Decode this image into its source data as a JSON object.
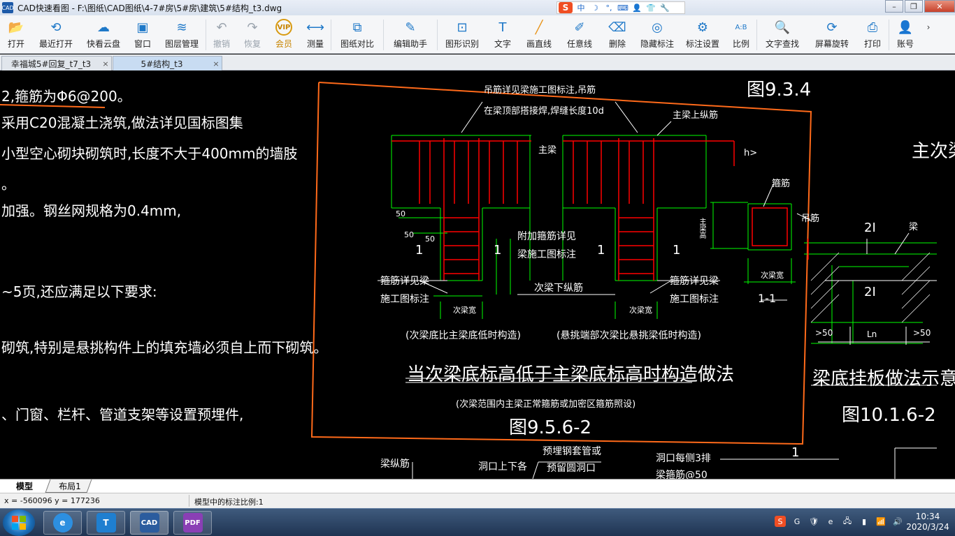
{
  "window": {
    "title": "CAD快速看图 - F:\\图纸\\CAD图纸\\4-7#房\\5#房\\建筑\\5#结构_t3.dwg",
    "app_icon_text": "CAD"
  },
  "ime": {
    "logo": "S",
    "items": [
      "中",
      "☽",
      "°,",
      "⌨",
      "👤",
      "👕",
      "🔧"
    ]
  },
  "toolbar": {
    "items": [
      {
        "label": "打开",
        "icon": "folder-open-icon",
        "glyph": "📂"
      },
      {
        "label": "最近打开",
        "icon": "recent-icon",
        "glyph": "⟲"
      },
      {
        "label": "快看云盘",
        "icon": "cloud-icon",
        "glyph": "☁"
      },
      {
        "label": "窗口",
        "icon": "window-icon",
        "glyph": "▣"
      },
      {
        "label": "图层管理",
        "icon": "layers-icon",
        "glyph": "≋"
      },
      {
        "label": "撤销",
        "icon": "undo-icon",
        "glyph": "↶",
        "disabled": true
      },
      {
        "label": "恢复",
        "icon": "redo-icon",
        "glyph": "↷",
        "disabled": true
      },
      {
        "label": "会员",
        "icon": "vip-icon",
        "glyph": "VIP",
        "vip": true
      },
      {
        "label": "测量",
        "icon": "measure-icon",
        "glyph": "⟷"
      },
      {
        "label": "图纸对比",
        "icon": "compare-icon",
        "glyph": "⧉"
      },
      {
        "label": "编辑助手",
        "icon": "edit-helper-icon",
        "glyph": "✎"
      },
      {
        "label": "图形识别",
        "icon": "shape-recognize-icon",
        "glyph": "⊡"
      },
      {
        "label": "文字",
        "icon": "text-icon",
        "glyph": "T"
      },
      {
        "label": "画直线",
        "icon": "line-icon",
        "glyph": "╱"
      },
      {
        "label": "任意线",
        "icon": "freehand-icon",
        "glyph": "✐"
      },
      {
        "label": "删除",
        "icon": "eraser-icon",
        "glyph": "⌫"
      },
      {
        "label": "隐藏标注",
        "icon": "hide-annotation-icon",
        "glyph": "◎"
      },
      {
        "label": "标注设置",
        "icon": "annotation-settings-icon",
        "glyph": "⚙"
      },
      {
        "label": "比例",
        "icon": "scale-icon",
        "glyph": "A:B"
      },
      {
        "label": "文字查找",
        "icon": "text-search-icon",
        "glyph": "🔍"
      },
      {
        "label": "屏幕旋转",
        "icon": "rotate-screen-icon",
        "glyph": "⟳"
      },
      {
        "label": "打印",
        "icon": "print-icon",
        "glyph": "⎙"
      },
      {
        "label": "账号",
        "icon": "account-icon",
        "glyph": "👤"
      }
    ]
  },
  "tabs": [
    {
      "label": "幸福城5#回复_t7_t3",
      "close": "×"
    },
    {
      "label": "5#结构_t3",
      "close": "×"
    }
  ],
  "drawing": {
    "left_notes": [
      "2,箍筋为Φ6@200。",
      "采用C20混凝土浇筑,做法详见国标图集",
      "小型空心砌块砌筑时,长度不大于400mm的墙肢",
      "。",
      "加强。钢丝网规格为0.4mm,",
      "~5页,还应满足以下要求:",
      "砌筑,特别是悬挑构件上的填充墙必须自上而下砌筑。",
      "、门窗、栏杆、管道支架等设置预埋件,"
    ],
    "fig_934": "图9.3.4",
    "label_hanger": "吊筋详见梁施工图标注,吊筋",
    "label_hanger2": "在梁顶部搭接焊,焊缝长度10d",
    "label_main_beam": "主梁",
    "label_main_top_bar": "主梁上纵筋",
    "label_h": "h>",
    "label_50a": "50",
    "label_50b": "50",
    "label_50c": "50",
    "label_1a": "1",
    "label_1b": "1",
    "label_1c": "1",
    "label_1d": "1",
    "label_additional_stirrup": "附加箍筋详见",
    "label_additional_stirrup2": "梁施工图标注",
    "label_stirrup_left": "箍筋详见梁",
    "label_stirrup_left2": "施工图标注",
    "label_stirrup_right": "箍筋详见梁",
    "label_stirrup_right2": "施工图标注",
    "label_secondary_bottom": "次梁下纵筋",
    "label_sec_width1": "次梁宽",
    "label_sec_width2": "次梁宽",
    "caption_left": "(次梁底比主梁底低时构造)",
    "caption_right": "(悬挑端部次梁比悬挑梁低时构造)",
    "section_stirrup": "箍筋",
    "section_hanger": "吊筋",
    "section_main_depth": "主梁高",
    "section_width": "次梁宽",
    "section_label": "1-1",
    "main_title": "当次梁底标高低于主梁底标高时构造做法",
    "sub_title": "(次梁范围内主梁正常箍筋或加密区箍筋照设)",
    "fig_956": "图9.5.6-2",
    "right_title_partial": "主次梁等",
    "label_21a": "2Ⅰ",
    "label_beam": "梁",
    "label_21b": "2Ⅰ",
    "label_50d": ">50",
    "label_ln": "Ln",
    "label_50e": ">50",
    "right_title": "梁底挂板做法示意",
    "fig_1016": "图10.1.6-2",
    "bottom_beam_bar": "梁纵筋",
    "bottom_hole": "洞口上下各",
    "bottom_pipe": "预埋钢套管或",
    "bottom_pipe2": "预留圆洞口",
    "bottom_each_side": "洞口每侧3排",
    "bottom_stirrup": "梁箍筋@50",
    "bottom_1": "1"
  },
  "layout_tabs": [
    {
      "label": "模型",
      "active": true
    },
    {
      "label": "布局1",
      "active": false
    }
  ],
  "status": {
    "coords": "x = -560096  y = 177236",
    "scale": "模型中的标注比例:1"
  },
  "taskbar": {
    "apps": [
      {
        "name": "ie",
        "glyph": "e",
        "color": "#2d8fe0"
      },
      {
        "name": "t-app",
        "glyph": "T",
        "color": "#1f7fd0"
      },
      {
        "name": "cad",
        "glyph": "CAD",
        "color": "#2b5c9e"
      },
      {
        "name": "pdf",
        "glyph": "PDF",
        "color": "#8a3fb5"
      }
    ],
    "tray_icons": [
      "S",
      "G",
      "🛡",
      "e",
      "🖧",
      "▮",
      "📶",
      "🔊"
    ],
    "time": "10:34",
    "date": "2020/3/24"
  },
  "colors": {
    "cad_white": "#ffffff",
    "cad_green": "#00ff00",
    "cad_red": "#ff0000",
    "cad_orange": "#ff6a1a",
    "toolbar_blue": "#1e78c8"
  }
}
